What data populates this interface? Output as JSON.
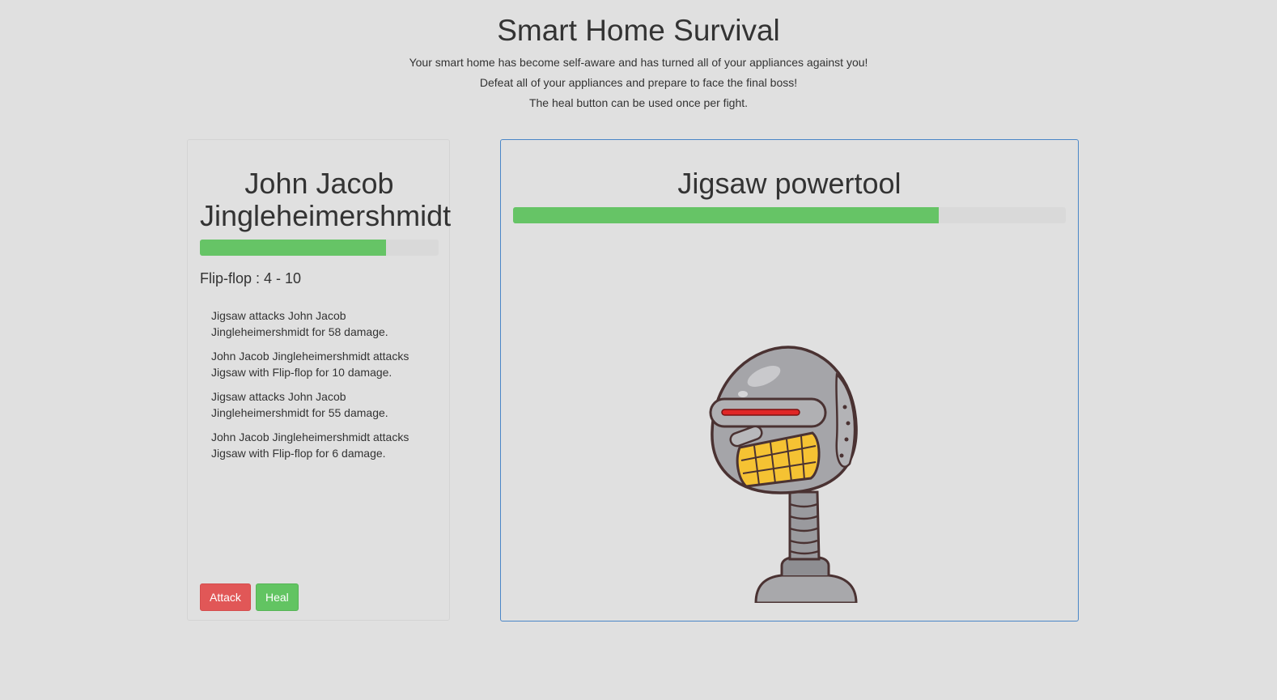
{
  "header": {
    "title": "Smart Home Survival",
    "lines": [
      "Your smart home has become self-aware and has turned all of your appliances against you!",
      "Defeat all of your appliances and prepare to face the final boss!",
      "The heal button can be used once per fight."
    ]
  },
  "player": {
    "name": "John Jacob Jingleheimershmidt",
    "hp_fraction": 0.78,
    "weapon": "Flip-flop : 4 - 10",
    "log": [
      "Jigsaw attacks John Jacob Jingleheimershmidt for 58 damage.",
      "John Jacob Jingleheimershmidt attacks Jigsaw with Flip-flop for 10 damage.",
      "Jigsaw attacks John Jacob Jingleheimershmidt for 55 damage.",
      "John Jacob Jingleheimershmidt attacks Jigsaw with Flip-flop for 6 damage."
    ],
    "attack_label": "Attack",
    "heal_label": "Heal"
  },
  "enemy": {
    "name": "Jigsaw powertool",
    "hp_fraction": 0.77,
    "image": "robot-illustration"
  },
  "colors": {
    "background": "#e0e0e0",
    "hp_bar": "#66c466",
    "attack": "#e15757",
    "heal": "#62c462",
    "enemy_border": "#4a86c7"
  }
}
